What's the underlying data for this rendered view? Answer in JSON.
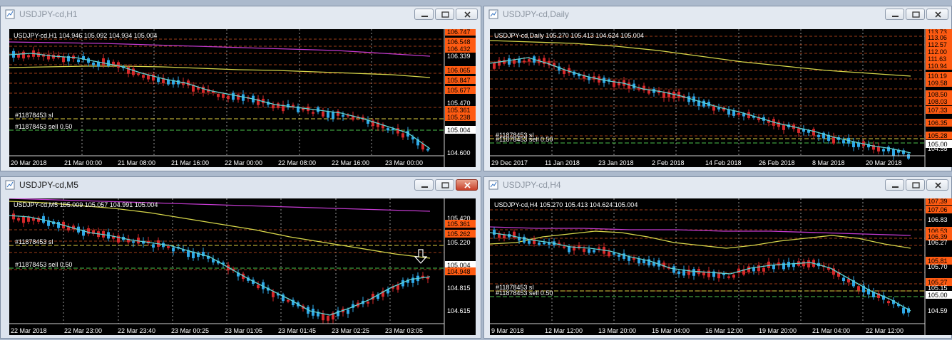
{
  "windows": [
    {
      "id": "h1",
      "title": "USDJPY-cd,H1",
      "active": false,
      "header": "USDJPY-cd,H1  104.946 105.092 104.934 105.004",
      "order_labels": [
        "#11878453 sl",
        "#11878453 sell 0.50"
      ],
      "price_ticks": [
        "106.747",
        "106.548",
        "106.432",
        "106.339",
        "106.065",
        "105.847",
        "105.677",
        "105.470",
        "105.361",
        "105.238",
        "105.004",
        "104.600"
      ],
      "time_ticks": [
        "20 Mar 2018",
        "21 Mar 00:00",
        "21 Mar 08:00",
        "21 Mar 16:00",
        "22 Mar 00:00",
        "22 Mar 08:00",
        "22 Mar 16:00",
        "23 Mar 00:00"
      ]
    },
    {
      "id": "daily",
      "title": "USDJPY-cd,Daily",
      "active": false,
      "header": "USDJPY-cd,Daily  105.270 105.413 104.624 105.004",
      "order_labels": [
        "#11878453 sl",
        "#11878453 sell 0.50"
      ],
      "price_ticks": [
        "113.73",
        "113.06",
        "112.57",
        "112.00",
        "111.63",
        "110.94",
        "110.19",
        "109.58",
        "108.50",
        "108.03",
        "107.33",
        "106.35",
        "105.28",
        "105.00",
        "104.55"
      ],
      "time_ticks": [
        "29 Dec 2017",
        "11 Jan 2018",
        "23 Jan 2018",
        "2 Feb 2018",
        "14 Feb 2018",
        "26 Feb 2018",
        "8 Mar 2018",
        "20 Mar 2018"
      ]
    },
    {
      "id": "m5",
      "title": "USDJPY-cd,M5",
      "active": true,
      "header": "USDJPY-cd,M5  105.009 105.057 104.991 105.004",
      "order_labels": [
        "#11878453 sl",
        "#11878453 sell 0.50"
      ],
      "price_ticks": [
        "105.420",
        "105.361",
        "105.262",
        "105.220",
        "105.004",
        "104.948",
        "104.815",
        "104.615"
      ],
      "time_ticks": [
        "22 Mar 2018",
        "22 Mar 23:00",
        "22 Mar 23:40",
        "23 Mar 00:25",
        "23 Mar 01:05",
        "23 Mar 01:45",
        "23 Mar 02:25",
        "23 Mar 03:05"
      ]
    },
    {
      "id": "h4",
      "title": "USDJPY-cd,H4",
      "active": false,
      "header": "USDJPY-cd,H4  105.270 105.413 104.624 105.004",
      "order_labels": [
        "#11878453 sl",
        "#11878453 sell 0.50"
      ],
      "price_ticks": [
        "107.39",
        "107.06",
        "106.83",
        "106.53",
        "106.39",
        "106.27",
        "105.81",
        "105.70",
        "105.27",
        "105.15",
        "105.00",
        "104.59"
      ],
      "time_ticks": [
        "9 Mar 2018",
        "12 Mar 12:00",
        "13 Mar 20:00",
        "15 Mar 04:00",
        "16 Mar 12:00",
        "19 Mar 20:00",
        "21 Mar 04:00",
        "22 Mar 12:00"
      ]
    }
  ],
  "colors": {
    "bull": "#2ea8e8",
    "bear": "#d6282a",
    "ma_fast": "#5fd3d3",
    "ma_slow": "#d6d64a",
    "ma_long": "#c33ad0",
    "level": "#d6531f",
    "sl": "#e0d040",
    "entry": "#4cc44c",
    "highlight_tag": "#ff5b12",
    "current_tag": "#ffffff"
  }
}
